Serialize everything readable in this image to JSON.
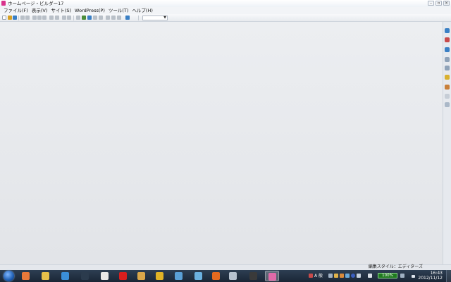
{
  "window": {
    "title": "ホームページ・ビルダー17"
  },
  "menu": {
    "items": [
      {
        "label": "ファイル(F)"
      },
      {
        "label": "表示(V)"
      },
      {
        "label": "サイト(S)"
      },
      {
        "label": "WordPress(P)"
      },
      {
        "label": "ツール(T)"
      },
      {
        "label": "ヘルプ(H)"
      }
    ]
  },
  "toolbar": {
    "style_select_value": ""
  },
  "statusbar": {
    "edit_style": "編集スタイル：エディターズ"
  },
  "taskbar": {
    "apps": [
      {
        "icon": "windows-media-player-icon",
        "color": "#e8793a"
      },
      {
        "icon": "file-explorer-icon",
        "color": "#e8c14a"
      },
      {
        "icon": "internet-explorer-icon",
        "color": "#3b8fd9"
      },
      {
        "icon": "task-app-icon",
        "color": "#2b3b4d"
      },
      {
        "icon": "excel-like-app-icon",
        "color": "#e8e8e8"
      },
      {
        "icon": "yahoo-icon",
        "color": "#d81e1e"
      },
      {
        "icon": "tool-app-icon",
        "color": "#d9a64a"
      },
      {
        "icon": "chrome-icon",
        "color": "#e0b326"
      },
      {
        "icon": "app-green-icon",
        "color": "#5aa0d6"
      },
      {
        "icon": "app-blue-icon",
        "color": "#6bb1e0"
      },
      {
        "icon": "firefox-icon",
        "color": "#e56a1f"
      },
      {
        "icon": "window-app-icon",
        "color": "#b6c2cf"
      },
      {
        "icon": "homepage-builder-dark-icon",
        "color": "#3a3a3a"
      },
      {
        "icon": "homepage-builder-icon",
        "color": "#e06aa8"
      }
    ],
    "tray": {
      "ime_label": "A 般",
      "battery_percent": "100%",
      "time": "16:43",
      "date": "2012/11/12"
    }
  }
}
